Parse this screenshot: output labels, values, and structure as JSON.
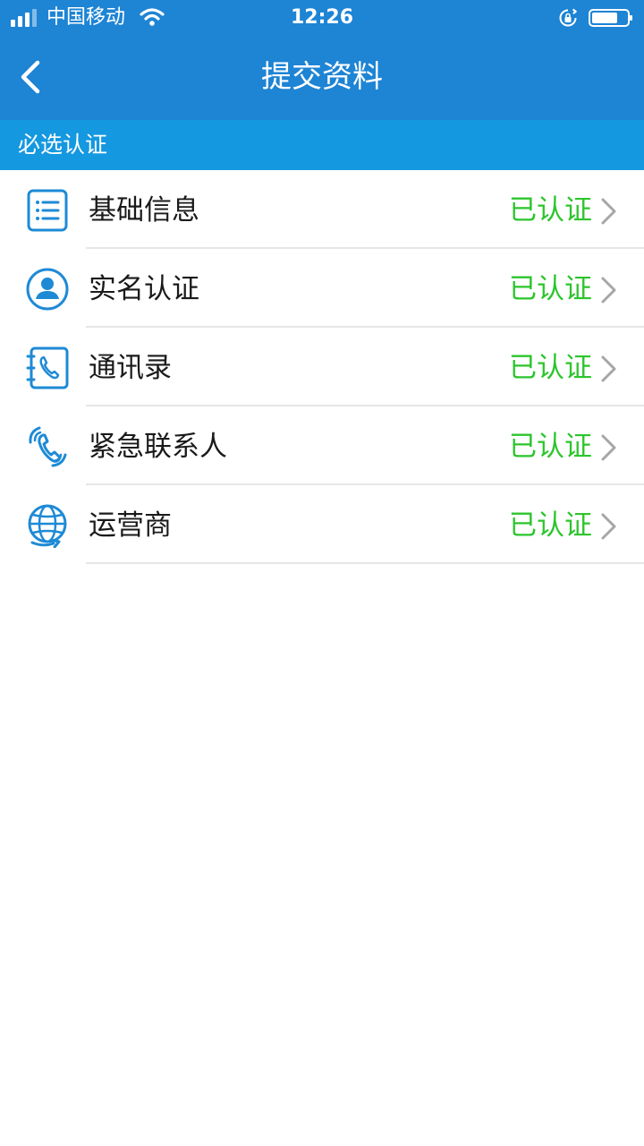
{
  "status_bar": {
    "carrier": "中国移动",
    "time": "12:26"
  },
  "nav": {
    "title": "提交资料",
    "back_icon": "chevron-left-icon"
  },
  "section": {
    "title": "必选认证"
  },
  "items": [
    {
      "label": "基础信息",
      "status": "已认证",
      "icon": "list-icon"
    },
    {
      "label": "实名认证",
      "status": "已认证",
      "icon": "user-icon"
    },
    {
      "label": "通讯录",
      "status": "已认证",
      "icon": "contacts-book-icon"
    },
    {
      "label": "紧急联系人",
      "status": "已认证",
      "icon": "phone-call-icon"
    },
    {
      "label": "运营商",
      "status": "已认证",
      "icon": "globe-icon"
    }
  ],
  "colors": {
    "header": "#1e84d4",
    "section_header": "#1498e0",
    "icon": "#1e8ad6",
    "verified": "#2cc52c"
  }
}
